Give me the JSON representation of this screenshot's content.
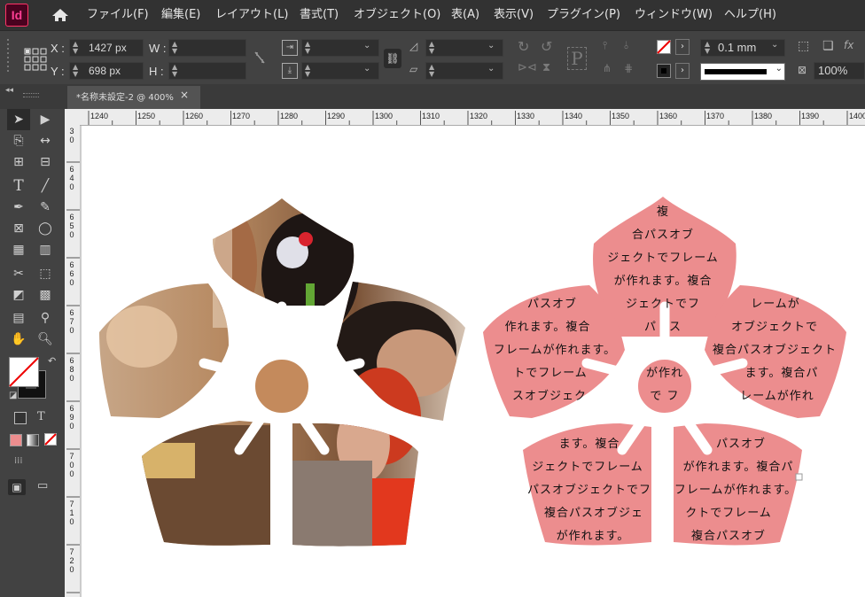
{
  "app": {
    "logo": "Id"
  },
  "menu": [
    {
      "label": "ファイル(F)"
    },
    {
      "label": "編集(E)"
    },
    {
      "label": "レイアウト(L)"
    },
    {
      "label": "書式(T)"
    },
    {
      "label": "オブジェクト(O)"
    },
    {
      "label": "表(A)"
    },
    {
      "label": "表示(V)"
    },
    {
      "label": "プラグイン(P)"
    },
    {
      "label": "ウィンドウ(W)"
    },
    {
      "label": "ヘルプ(H)"
    }
  ],
  "control": {
    "x_label": "X :",
    "x_value": "1427 px",
    "y_label": "Y :",
    "y_value": "698 px",
    "w_label": "W :",
    "h_label": "H :",
    "stroke_weight": "0.1 mm",
    "zoom": "100%",
    "fx_label": "fx"
  },
  "document_tab": {
    "title": "*名称未設定-2 @ 400%",
    "close": "×"
  },
  "ruler": {
    "top": [
      "1240",
      "1250",
      "1260",
      "1270",
      "1280",
      "1290",
      "1300",
      "1310",
      "1320",
      "1330",
      "1340",
      "1350",
      "1360",
      "1370",
      "1380",
      "1390",
      "1400"
    ],
    "left": [
      [
        "3",
        "0"
      ],
      [
        "6",
        "4",
        "0"
      ],
      [
        "6",
        "5",
        "0"
      ],
      [
        "6",
        "6",
        "0"
      ],
      [
        "6",
        "7",
        "0"
      ],
      [
        "6",
        "8",
        "0"
      ],
      [
        "6",
        "9",
        "0"
      ],
      [
        "7",
        "0",
        "0"
      ],
      [
        "7",
        "1",
        "0"
      ],
      [
        "7",
        "2",
        "0"
      ]
    ]
  },
  "colors": {
    "flower_fill": "#ec8d8e",
    "accent": "#ff3366"
  },
  "flower_text": {
    "top": [
      "複",
      "合パスオブ",
      "ジェクトでフレーム",
      "が作れます。複合",
      "ジェクトでフ",
      "パ　ス"
    ],
    "left": [
      "パスオブ",
      "作れます。複合",
      "フレームが作れます。",
      "トでフレーム",
      "スオブジェク"
    ],
    "right": [
      "レームが",
      "オブジェクトで",
      "複合パスオブジェクト",
      "ます。複合パ",
      "レームが作れ"
    ],
    "center": [
      "が作れ",
      "で フ"
    ],
    "bottom_left": [
      "ます。複合",
      "ジェクトでフレーム",
      "パスオブジェクトでフ",
      "複合パスオブジェ",
      "が作れます。"
    ],
    "bottom_right": [
      "パスオブ",
      "が作れます。複合パ",
      "フレームが作れます。",
      "クトでフレーム",
      "複合パスオブ"
    ]
  }
}
